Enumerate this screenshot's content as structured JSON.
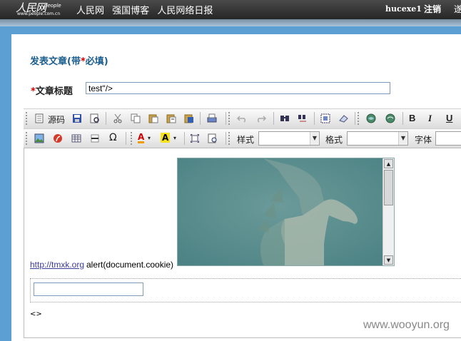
{
  "topbar": {
    "logo_cn": "人民网",
    "logo_en": "people",
    "logo_url": "www.people.com.cn",
    "links": [
      "人民网",
      "强国博客",
      "人民网络日报"
    ],
    "username": "hucexe1",
    "logout": "注销",
    "cut": "遂"
  },
  "form": {
    "heading_prefix": "发表文章(带",
    "heading_star": "*",
    "heading_suffix": "必填)",
    "title_star": "*",
    "title_label": "文章标题",
    "title_value": "test\"/>"
  },
  "toolbar": {
    "source_label": "源码",
    "style_label": "样式",
    "format_label": "格式",
    "font_label": "字体",
    "bold": "B",
    "italic": "I",
    "underline": "U",
    "font_color": "A",
    "bg_color": "A",
    "omega": "Ω"
  },
  "editor": {
    "link_text": "http://tmxk.org",
    "alert_text": "alert(document.cookie)",
    "bottom_text": "<>"
  },
  "watermark": "www.wooyun.org",
  "colors": {
    "topbar": "#2e2e2e",
    "background": "#5b9fd3",
    "heading": "#1b5e8e",
    "required": "#dd0000"
  }
}
